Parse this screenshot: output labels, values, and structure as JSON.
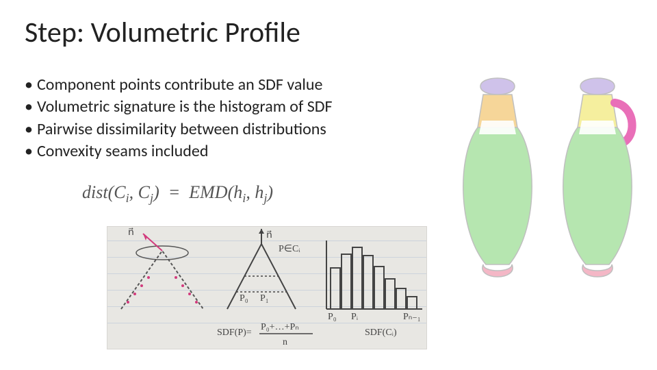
{
  "title": "Step: Volumetric Profile",
  "bullets": [
    "Component points contribute an SDF value",
    "Volumetric signature is the histogram of SDF",
    "Pairwise dissimilarity between distributions",
    "Convexity seams included"
  ],
  "formula": {
    "lhs_func": "dist",
    "lhs_arg1": "C",
    "lhs_sub1": "i",
    "lhs_arg2": "C",
    "lhs_sub2": "j",
    "rhs_func": "EMD",
    "rhs_arg1": "h",
    "rhs_sub1": "i",
    "rhs_arg2": "h",
    "rhs_sub2": "j"
  },
  "sketch_labels": {
    "n_vec_left": "n⃗",
    "n_vec_mid": "n⃗",
    "p_in_c": "P∈Cᵢ",
    "p0": "P₀",
    "p1": "P₁",
    "p0b": "P₀",
    "pi": "Pᵢ",
    "pn1": "Pₙ₋₁",
    "sdf_p": "SDF(P)=",
    "frac_top": "P₀+…+Pₙ",
    "frac_bot": "n",
    "sdf_ci": "SDF(Cᵢ)"
  },
  "colors": {
    "purple": "#cfc2ea",
    "orange": "#f6d699",
    "green": "#b6e6b0",
    "pink": "#f4b7c6",
    "magenta": "#e96fb8",
    "yellow": "#f5ef9e",
    "outline": "#bfbfbf"
  }
}
